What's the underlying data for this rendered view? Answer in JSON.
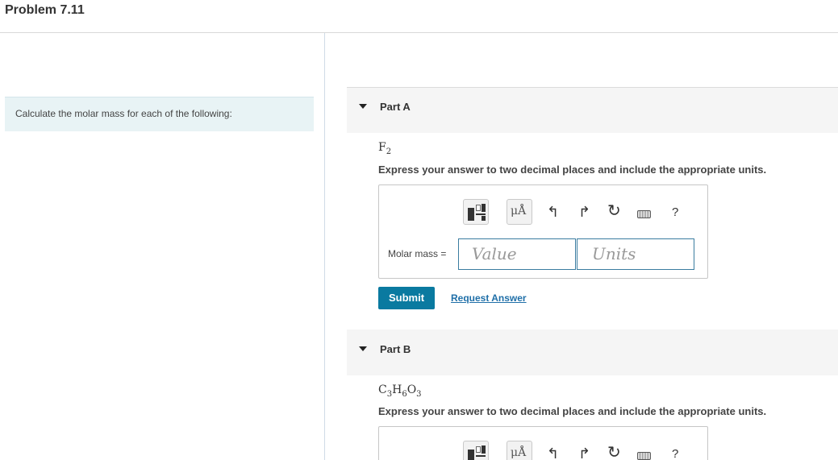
{
  "problem": {
    "title": "Problem 7.11",
    "prompt": "Calculate the molar mass for each of the following:"
  },
  "part_a": {
    "label": "Part A",
    "formula": {
      "symbols": [
        "F"
      ],
      "subscripts": [
        "2"
      ]
    },
    "instruction": "Express your answer to two decimal places and include the appropriate units.",
    "toolbar": {
      "templates_icon": "templates-icon",
      "units_symbol": "μÅ",
      "undo_icon": "undo-icon",
      "redo_icon": "redo-icon",
      "reset_icon": "reset-icon",
      "keyboard_icon": "keyboard-icon",
      "help_label": "?"
    },
    "field_label": "Molar mass =",
    "value_placeholder": "Value",
    "units_placeholder": "Units",
    "submit_label": "Submit",
    "request_label": "Request Answer"
  },
  "part_b": {
    "label": "Part B",
    "formula": {
      "symbols": [
        "C",
        "H",
        "O"
      ],
      "subscripts": [
        "3",
        "6",
        "3"
      ]
    },
    "instruction": "Express your answer to two decimal places and include the appropriate units.",
    "toolbar": {
      "units_symbol": "μÅ",
      "help_label": "?"
    }
  },
  "colors": {
    "submit_bg": "#0a7aa0",
    "link": "#1f6fa8",
    "problem_box_bg": "#e8f3f5",
    "input_border": "#3a7ca0"
  }
}
